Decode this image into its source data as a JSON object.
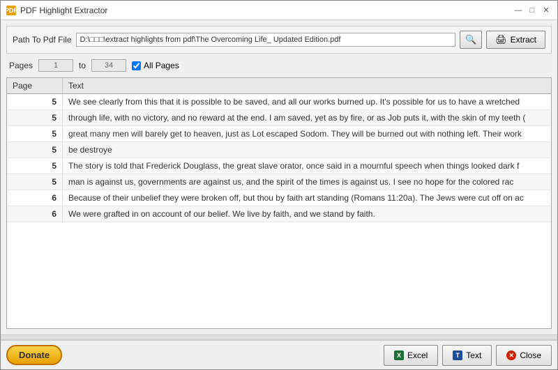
{
  "window": {
    "title": "PDF Highlight Extractor",
    "icon": "PDF",
    "controls": {
      "minimize": "—",
      "maximize": "□",
      "close": "✕"
    }
  },
  "path_row": {
    "label": "Path To Pdf File",
    "path_value": "D:\\□□□\\extract highlights from pdf\\The Overcoming Life_ Updated Edition.pdf",
    "search_btn_label": "🔍",
    "extract_btn_label": "Extract"
  },
  "pages_row": {
    "label": "Pages",
    "from_value": "1",
    "to_label": "to",
    "to_value": "34",
    "all_pages_label": "All Pages",
    "all_pages_checked": true
  },
  "table": {
    "columns": [
      {
        "id": "page",
        "label": "Page"
      },
      {
        "id": "text",
        "label": "Text"
      }
    ],
    "rows": [
      {
        "page": "5",
        "text": "We see clearly from this that it is possible to be saved, and all our works burned up. It's possible for us to have a wretched"
      },
      {
        "page": "5",
        "text": "through life, with no victory, and no reward at the end. I am saved, yet as by fire, or as Job puts it, with the skin of my teeth ("
      },
      {
        "page": "5",
        "text": "great many men will barely get to heaven, just as Lot escaped Sodom. They will be burned out with nothing left. Their work"
      },
      {
        "page": "5",
        "text": "be destroye"
      },
      {
        "page": "5",
        "text": "The story is told that Frederick Douglass, the great slave orator, once said in a mournful speech when things looked dark f"
      },
      {
        "page": "5",
        "text": "man is against us, governments are against us, and the spirit of the times is against us. I see no hope for the colored rac"
      },
      {
        "page": "6",
        "text": "Because of their unbelief they were broken off, but thou by faith art standing (Romans 11:20a). The Jews were cut off on ac"
      },
      {
        "page": "6",
        "text": "We were grafted in on account of our belief. We live by faith, and we stand by faith."
      }
    ]
  },
  "bottom": {
    "donate_label": "Donate",
    "excel_label": "Excel",
    "text_label": "Text",
    "close_label": "Close"
  }
}
